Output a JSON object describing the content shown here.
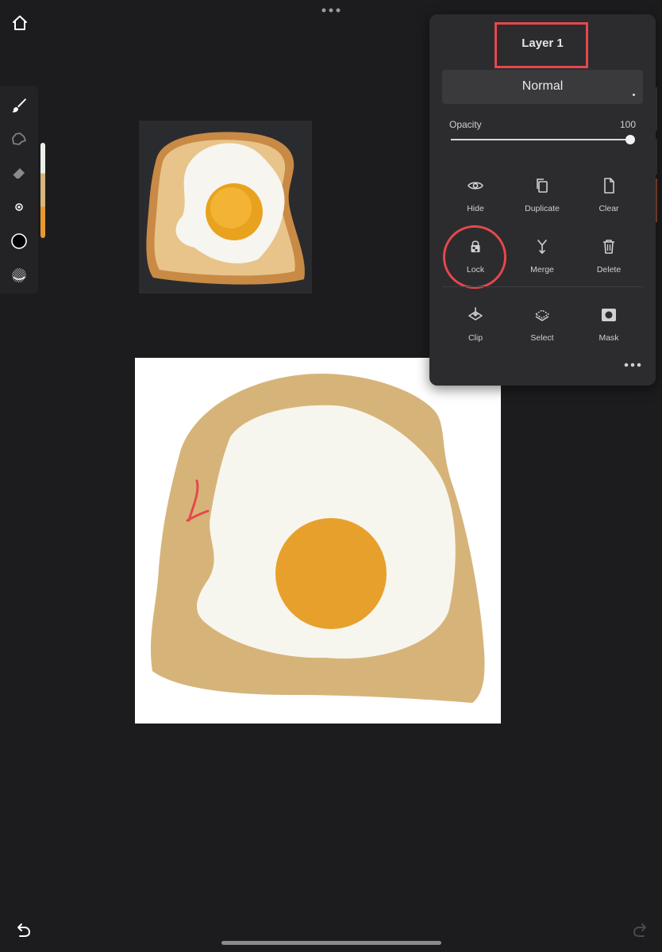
{
  "layer_panel": {
    "title": "Layer 1",
    "blend_mode": "Normal",
    "opacity_label": "Opacity",
    "opacity_value": "100",
    "opacity_fraction": 1.0,
    "actions_row1": [
      {
        "label": "Hide",
        "icon": "eye-icon"
      },
      {
        "label": "Duplicate",
        "icon": "duplicate-icon"
      },
      {
        "label": "Clear",
        "icon": "document-icon"
      }
    ],
    "actions_row2": [
      {
        "label": "Lock",
        "icon": "lock-icon"
      },
      {
        "label": "Merge",
        "icon": "merge-icon"
      },
      {
        "label": "Delete",
        "icon": "trash-icon"
      }
    ],
    "actions_row3": [
      {
        "label": "Clip",
        "icon": "clip-icon"
      },
      {
        "label": "Select",
        "icon": "select-icon"
      },
      {
        "label": "Mask",
        "icon": "mask-icon"
      }
    ]
  },
  "annotations": {
    "highlight_color": "#e5484d",
    "canvas_mark": "1"
  },
  "toolbar": {
    "tools": [
      "brush-icon",
      "smudge-icon",
      "eraser-icon",
      "brush-size-icon",
      "color-icon",
      "opacity-icon"
    ]
  },
  "colors": {
    "background": "#1c1c1e",
    "panel": "#2c2c2e",
    "toast": "#d6b479",
    "egg_white": "#f7f6ee",
    "yolk": "#e8a02c"
  }
}
